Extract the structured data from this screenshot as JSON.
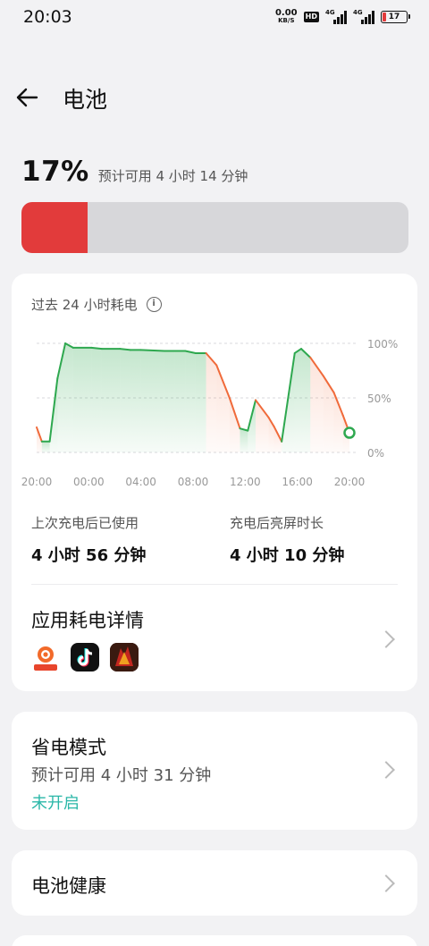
{
  "status_bar": {
    "time": "20:03",
    "speed_value": "0.00",
    "speed_unit": "KB/S",
    "hd_badge": "HD",
    "network1": "4G",
    "network2": "4G",
    "battery_text": "17"
  },
  "header": {
    "title": "电池"
  },
  "battery": {
    "level": "17%",
    "estimate": "预计可用 4 小时 14 分钟",
    "fraction": 0.17,
    "fill_color": "#e23b3b"
  },
  "usage_card": {
    "title": "过去 24 小时耗电",
    "stats": [
      {
        "label": "上次充电后已使用",
        "value": "4 小时 56 分钟"
      },
      {
        "label": "充电后亮屏时长",
        "value": "4 小时 10 分钟"
      }
    ],
    "app_section_title": "应用耗电详情",
    "apps": [
      "app-icon-1",
      "tiktok-icon",
      "game-icon"
    ]
  },
  "chart_data": {
    "type": "line",
    "y_ticks": [
      "100%",
      "50%",
      "0%"
    ],
    "x_ticks": [
      "20:00",
      "00:00",
      "04:00",
      "08:00",
      "12:00",
      "16:00",
      "20:00"
    ],
    "ylim": [
      0,
      100
    ],
    "xlim": [
      0,
      24
    ],
    "points": [
      [
        0,
        23
      ],
      [
        0.4,
        10
      ],
      [
        1.0,
        10
      ],
      [
        1.6,
        68
      ],
      [
        2.2,
        100
      ],
      [
        2.8,
        96
      ],
      [
        4.2,
        96
      ],
      [
        5,
        95
      ],
      [
        6.4,
        95
      ],
      [
        7.2,
        94
      ],
      [
        8,
        94
      ],
      [
        9.8,
        93
      ],
      [
        10.6,
        93
      ],
      [
        11.4,
        93
      ],
      [
        12.2,
        91
      ],
      [
        13,
        91
      ],
      [
        13.8,
        80
      ],
      [
        14.8,
        50
      ],
      [
        15.6,
        22
      ],
      [
        16.2,
        20
      ],
      [
        16.8,
        48
      ],
      [
        17.8,
        32
      ],
      [
        18.2,
        24
      ],
      [
        18.8,
        10
      ],
      [
        19.8,
        91
      ],
      [
        20.3,
        95
      ],
      [
        21,
        87
      ],
      [
        22,
        70
      ],
      [
        22.8,
        55
      ],
      [
        23.5,
        34
      ],
      [
        24,
        18
      ]
    ],
    "line_color": "#2ea84f",
    "drain_color": "#f06a3a"
  },
  "power_saving": {
    "title": "省电模式",
    "subtitle": "预计可用 4 小时 31 分钟",
    "status": "未开启"
  },
  "battery_health": {
    "title": "电池健康"
  }
}
